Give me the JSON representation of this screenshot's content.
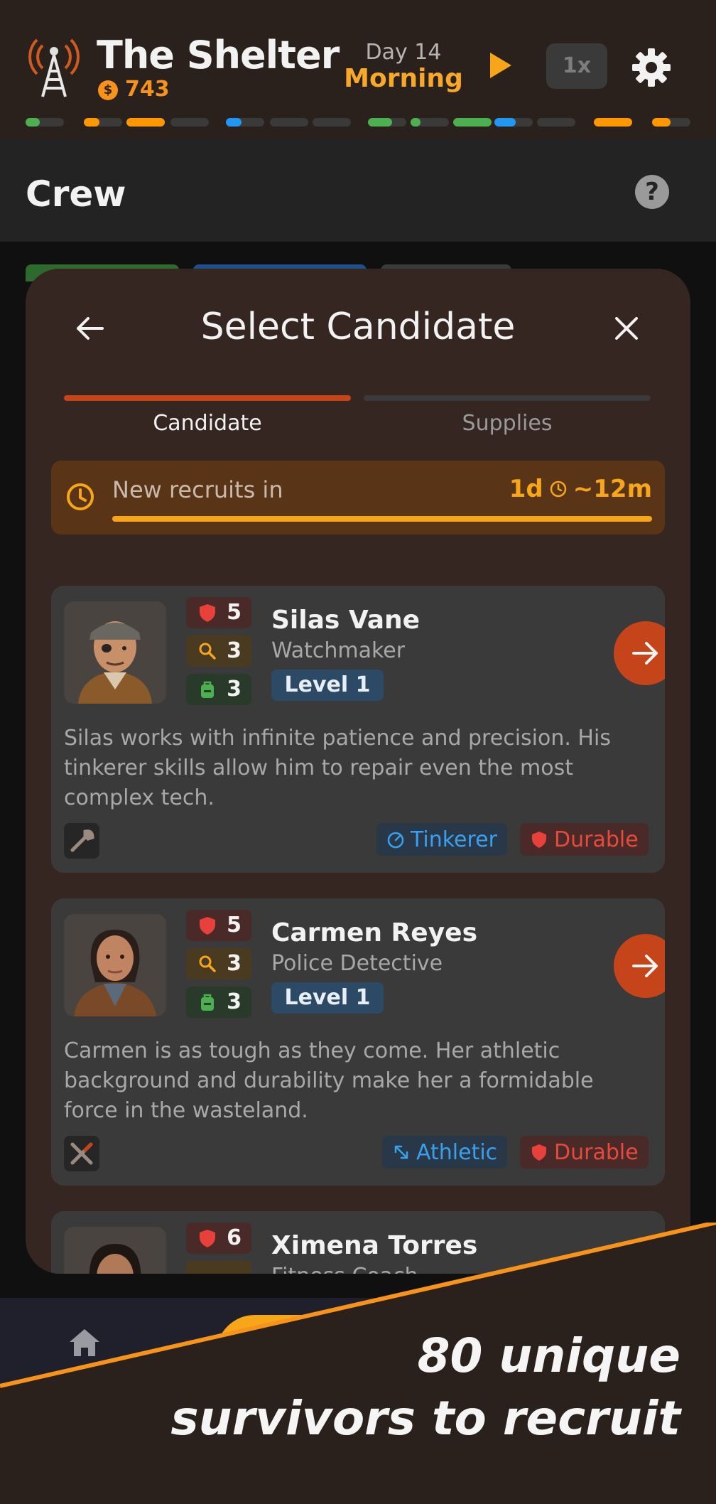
{
  "header": {
    "title": "The Shelter",
    "currency_symbol": "$",
    "money": "743",
    "day": "Day 14",
    "phase": "Morning",
    "speed": "1x",
    "icons": [
      "radio-tower-icon",
      "play-icon",
      "gear-icon"
    ],
    "timeline_colors": {
      "green": "#4caf50",
      "orange": "#ff9800",
      "blue": "#2196f3",
      "gray": "#3a3a3a"
    }
  },
  "crew": {
    "title": "Crew",
    "help_label": "?"
  },
  "modal": {
    "title": "Select Candidate",
    "steps": [
      {
        "label": "Candidate",
        "active": true
      },
      {
        "label": "Supplies",
        "active": false
      }
    ],
    "timer": {
      "label": "New recruits in",
      "value_days": "1d",
      "value_minutes": "~12m"
    },
    "candidates": [
      {
        "name": "Silas Vane",
        "occupation": "Watchmaker",
        "level": "Level 1",
        "stats": {
          "defense": "5",
          "search": "3",
          "carry": "3"
        },
        "description": "Silas works with infinite patience and precision. His tinkerer skills allow him to repair even the most complex tech.",
        "traits": [
          "Tinkerer",
          "Durable"
        ],
        "item_icon": "wrench-icon"
      },
      {
        "name": "Carmen Reyes",
        "occupation": "Police Detective",
        "level": "Level 1",
        "stats": {
          "defense": "5",
          "search": "3",
          "carry": "3"
        },
        "description": "Carmen is as tough as they come. Her athletic background and durability make her a formidable force in the wasteland.",
        "traits": [
          "Athletic",
          "Durable"
        ],
        "item_icon": "crossed-tools-icon"
      },
      {
        "name": "Ximena Torres",
        "occupation": "Fitness Coach",
        "stats": {
          "defense": "6"
        }
      }
    ]
  },
  "promo": {
    "line1": "80 unique",
    "line2": "survivors to recruit",
    "accent": "#f7931a"
  }
}
